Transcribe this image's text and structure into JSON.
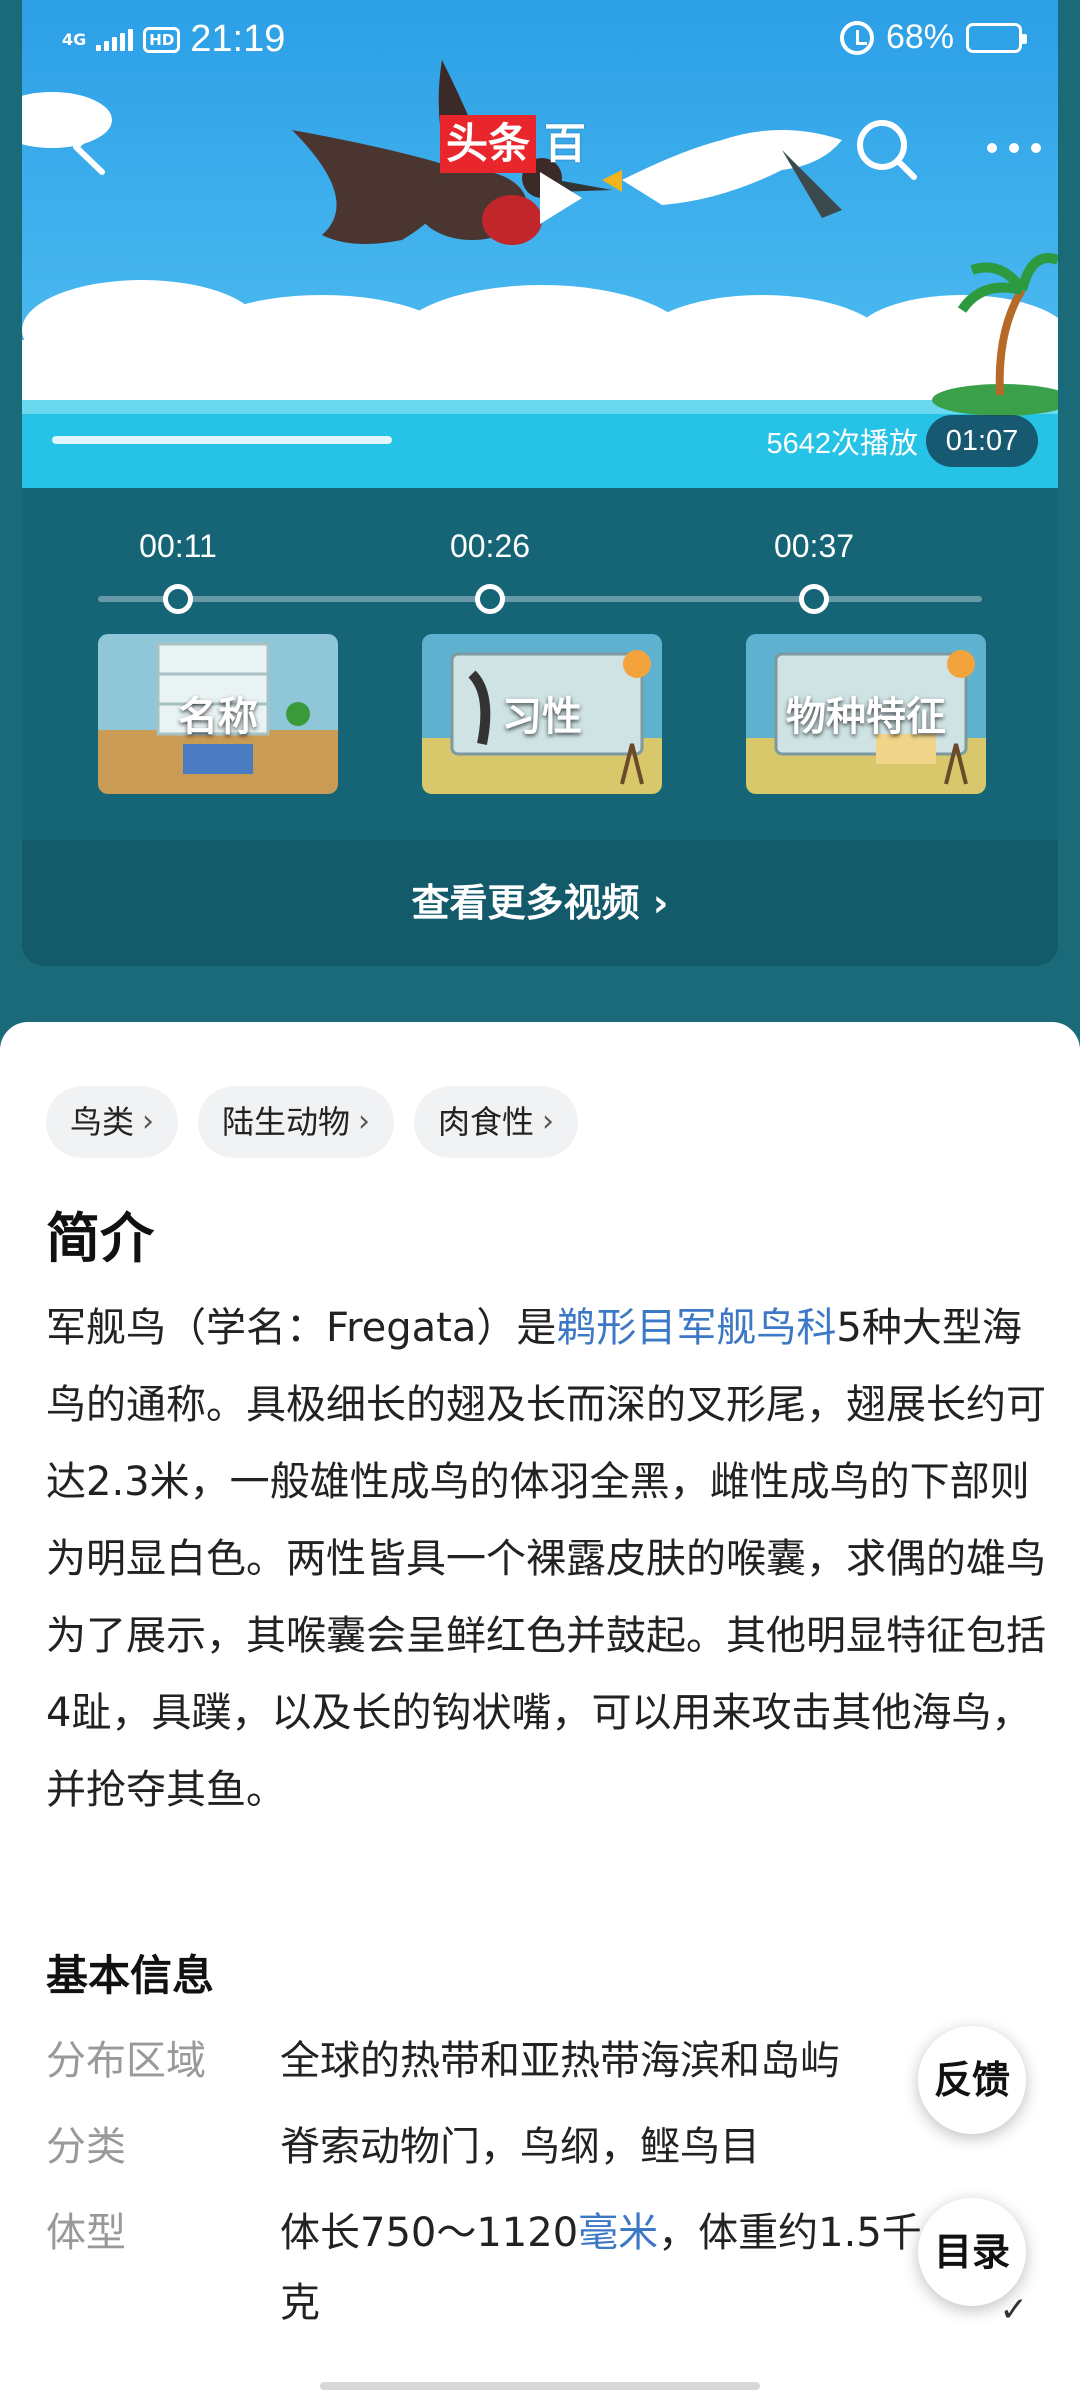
{
  "status_bar": {
    "network": "4G",
    "hd": "HD",
    "time": "21:19",
    "battery": "68%",
    "battery_level": 0.68
  },
  "video": {
    "brand_red": "头条",
    "brand_rest": "百",
    "views": "5642次播放",
    "duration": "01:07"
  },
  "chapters": [
    {
      "time": "00:11",
      "label": "名称"
    },
    {
      "time": "00:26",
      "label": "习性"
    },
    {
      "time": "00:37",
      "label": "物种特征"
    }
  ],
  "more_videos": "查看更多视频",
  "tags": [
    "鸟类",
    "陆生动物",
    "肉食性"
  ],
  "intro": {
    "title": "简介",
    "text_before": "军舰鸟（学名：Fregata）是",
    "link": "鹈形目军舰鸟科",
    "text_after": "5种大型海鸟的通称。具极细长的翅及长而深的叉形尾，翅展长约可达2.3米，一般雄性成鸟的体羽全黑，雌性成鸟的下部则为明显白色。两性皆具一个裸露皮肤的喉囊，求偶的雄鸟为了展示，其喉囊会呈鲜红色并鼓起。其他明显特征包括4趾，具蹼，以及长的钩状嘴，可以用来攻击其他海鸟，并抢夺其鱼。"
  },
  "basic_info": {
    "title": "基本信息",
    "rows": [
      {
        "key": "分布区域",
        "value": "全球的热带和亚热带海滨和岛屿"
      },
      {
        "key": "分类",
        "value": "脊索动物门，鸟纲，鲣鸟目"
      },
      {
        "key": "体型",
        "value_before": "体长750～1120",
        "link": "毫米",
        "value_after": "，体重约1.5千",
        "value_line2": "克"
      }
    ]
  },
  "fab": {
    "feedback": "反馈",
    "toc": "目录"
  },
  "colors": {
    "accent_link": "#3d78c6",
    "panel": "#166577",
    "brand_red": "#e8262c"
  }
}
